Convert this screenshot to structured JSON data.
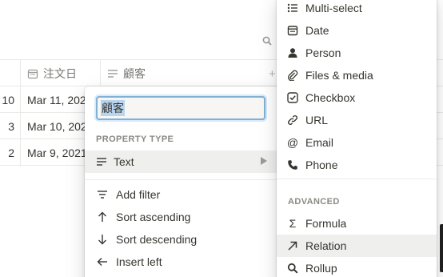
{
  "table": {
    "columns": [
      {
        "icon": "calendar-icon",
        "label": "注文日"
      },
      {
        "icon": "text-icon",
        "label": "顧客"
      }
    ],
    "rows": [
      {
        "number": "10",
        "date": "Mar 11, 202"
      },
      {
        "number": "3",
        "date": "Mar 10, 202"
      },
      {
        "number": "2",
        "date": "Mar 9, 2021"
      }
    ]
  },
  "property_menu": {
    "name_value": "顧客",
    "property_type_label": "PROPERTY TYPE",
    "current_type": "Text",
    "actions": [
      {
        "icon": "filter-icon",
        "label": "Add filter"
      },
      {
        "icon": "arrow-up-icon",
        "label": "Sort ascending"
      },
      {
        "icon": "arrow-down-icon",
        "label": "Sort descending"
      },
      {
        "icon": "arrow-left-icon",
        "label": "Insert left"
      }
    ]
  },
  "type_menu": {
    "basic_items": [
      {
        "icon": "list-icon",
        "label": "Multi-select"
      },
      {
        "icon": "calendar-icon",
        "label": "Date"
      },
      {
        "icon": "person-icon",
        "label": "Person"
      },
      {
        "icon": "paperclip-icon",
        "label": "Files & media"
      },
      {
        "icon": "checkbox-icon",
        "label": "Checkbox"
      },
      {
        "icon": "link-icon",
        "label": "URL"
      },
      {
        "icon": "at-icon",
        "label": "Email"
      },
      {
        "icon": "phone-icon",
        "label": "Phone"
      }
    ],
    "advanced_label": "ADVANCED",
    "advanced_items": [
      {
        "icon": "sigma-icon",
        "label": "Formula"
      },
      {
        "icon": "arrow-up-right-icon",
        "label": "Relation",
        "highlighted": true
      },
      {
        "icon": "search-icon",
        "label": "Rollup"
      }
    ]
  }
}
